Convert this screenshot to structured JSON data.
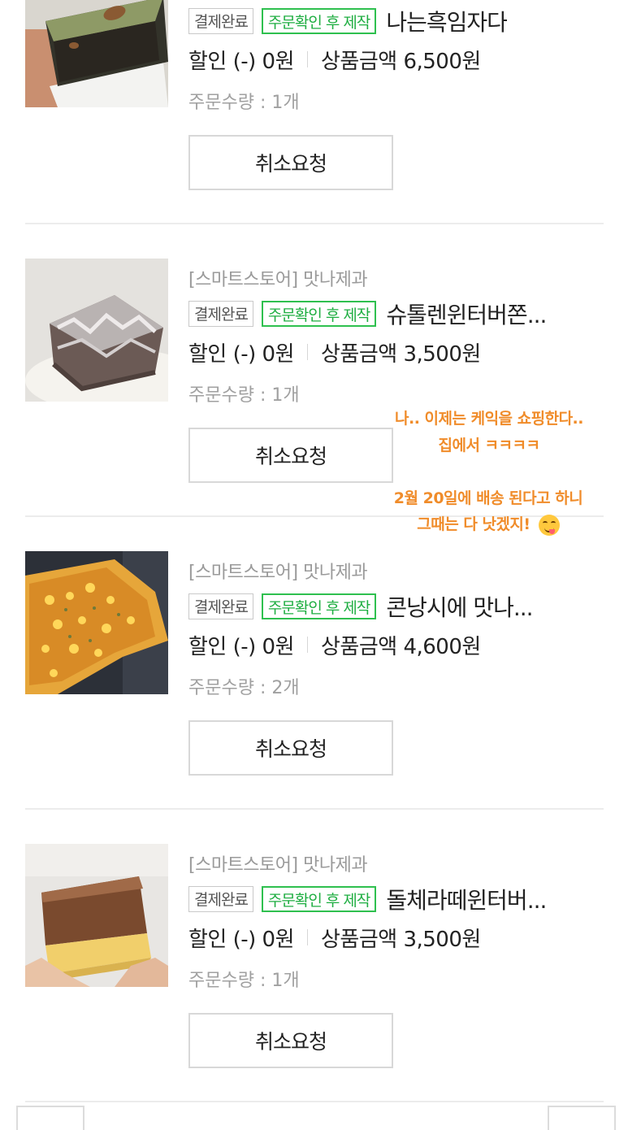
{
  "orders": [
    {
      "store": "",
      "status_badge": "결제완료",
      "make_badge": "주문확인 후 제작",
      "product_name": "나는흑임자다",
      "discount": "할인 (-) 0원",
      "amount": "상품금액 6,500원",
      "quantity": "주문수량 : 1개",
      "cancel_label": "취소요청",
      "thumbnail_icon": "black-sesame-cake-photo"
    },
    {
      "store": "[스마트스토어] 맛나제과",
      "status_badge": "결제완료",
      "make_badge": "주문확인 후 제작",
      "product_name": "슈톨렌윈터버쫀...",
      "discount": "할인 (-) 0원",
      "amount": "상품금액 3,500원",
      "quantity": "주문수량 : 1개",
      "cancel_label": "취소요청",
      "thumbnail_icon": "stollen-cake-photo"
    },
    {
      "store": "[스마트스토어] 맛나제과",
      "status_badge": "결제완료",
      "make_badge": "주문확인 후 제작",
      "product_name": "콘낭시에 맛나...",
      "discount": "할인 (-) 0원",
      "amount": "상품금액 4,600원",
      "quantity": "주문수량 : 2개",
      "cancel_label": "취소요청",
      "thumbnail_icon": "corn-financier-photo"
    },
    {
      "store": "[스마트스토어] 맛나제과",
      "status_badge": "결제완료",
      "make_badge": "주문확인 후 제작",
      "product_name": "돌체라떼윈터버...",
      "discount": "할인 (-) 0원",
      "amount": "상품금액 3,500원",
      "quantity": "주문수량 : 1개",
      "cancel_label": "취소요청",
      "thumbnail_icon": "dolce-latte-cake-photo"
    }
  ],
  "annotations": {
    "line1": "나.. 이제는 케익을 쇼핑한다..",
    "line2": "집에서 ㅋㅋㅋㅋ",
    "line3": "2월 20일에 배송 된다고 하니",
    "line4": "그때는 다 낫겠지!",
    "emoji_icon": "yum-face-emoji",
    "color": "#f08c2a"
  },
  "colors": {
    "green_badge": "#2fc04f",
    "divider": "#ececec",
    "muted_text": "#9a9a9a"
  }
}
